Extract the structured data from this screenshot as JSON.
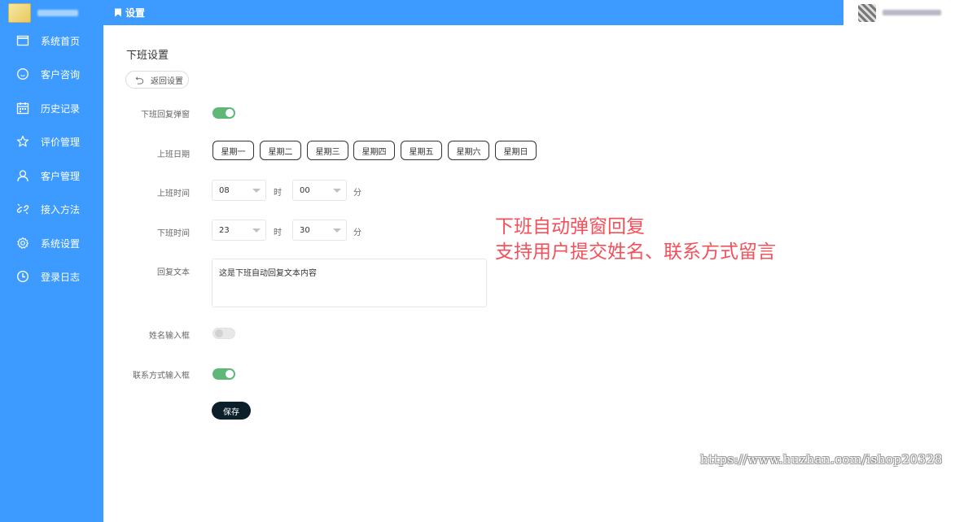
{
  "header": {
    "title": "设置"
  },
  "sidebar": {
    "items": [
      {
        "label": "系统首页",
        "icon": "window-icon"
      },
      {
        "label": "客户咨询",
        "icon": "chat-icon"
      },
      {
        "label": "历史记录",
        "icon": "calendar-icon"
      },
      {
        "label": "评价管理",
        "icon": "star-icon"
      },
      {
        "label": "客户管理",
        "icon": "user-icon"
      },
      {
        "label": "接入方法",
        "icon": "link-icon"
      },
      {
        "label": "系统设置",
        "icon": "gear-icon"
      },
      {
        "label": "登录日志",
        "icon": "clock-icon"
      }
    ]
  },
  "page": {
    "title": "下班设置",
    "back_label": "返回设置"
  },
  "form": {
    "popup_label": "下班回复弹窗",
    "popup_enabled": true,
    "workdays_label": "上班日期",
    "days": [
      "星期一",
      "星期二",
      "星期三",
      "星期四",
      "星期五",
      "星期六",
      "星期日"
    ],
    "start_label": "上班时间",
    "start_hour": "08",
    "start_minute": "00",
    "end_label": "下班时间",
    "end_hour": "23",
    "end_minute": "30",
    "hour_unit": "时",
    "minute_unit": "分",
    "reply_label": "回复文本",
    "reply_text": "这是下班自动回复文本内容",
    "name_label": "姓名输入框",
    "name_enabled": false,
    "contact_label": "联系方式输入框",
    "contact_enabled": true,
    "save_label": "保存"
  },
  "annotation": {
    "line1": "下班自动弹窗回复",
    "line2": "支持用户提交姓名、联系方式留言"
  },
  "watermark": "https://www.huzhan.com/ishop20328",
  "colors": {
    "primary": "#3d9bff",
    "toggle_on": "#5fb878",
    "save_button": "#0b1f2b",
    "annotation": "#f5505a"
  }
}
